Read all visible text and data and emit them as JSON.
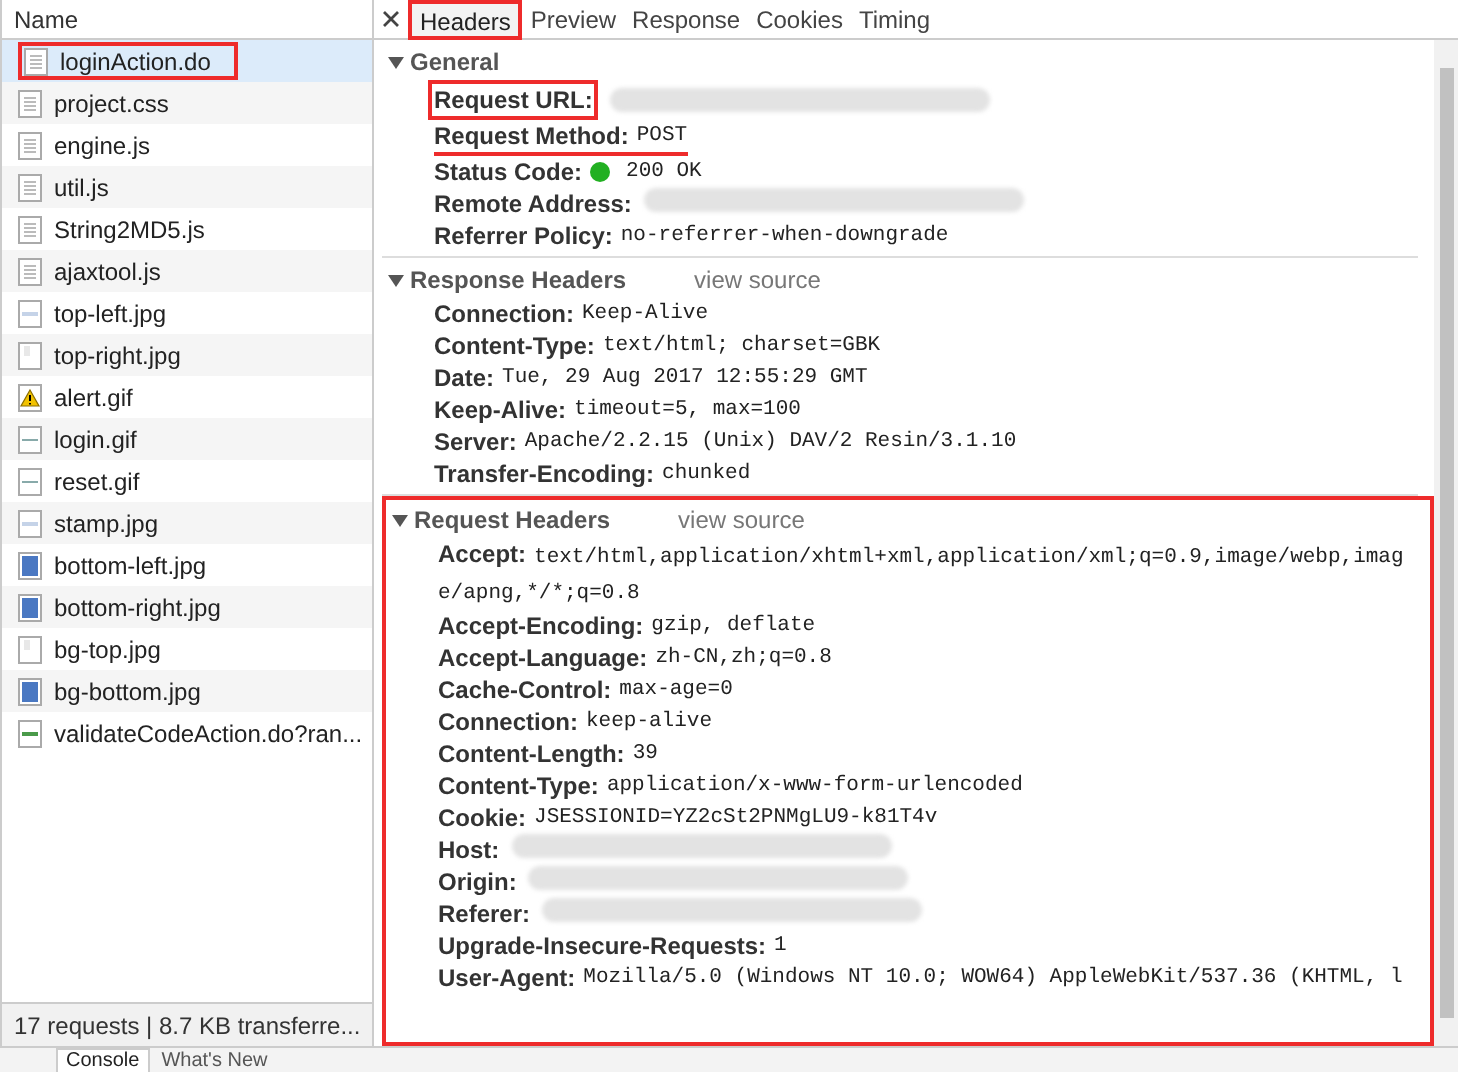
{
  "files": {
    "column": "Name",
    "items": [
      {
        "name": "loginAction.do",
        "kind": "document",
        "selected": true,
        "boxed": true
      },
      {
        "name": "project.css",
        "kind": "document",
        "selected": false
      },
      {
        "name": "engine.js",
        "kind": "document",
        "selected": false
      },
      {
        "name": "util.js",
        "kind": "document",
        "selected": false
      },
      {
        "name": "String2MD5.js",
        "kind": "document",
        "selected": false
      },
      {
        "name": "ajaxtool.js",
        "kind": "document",
        "selected": false
      },
      {
        "name": "top-left.jpg",
        "kind": "image-light",
        "selected": false
      },
      {
        "name": "top-right.jpg",
        "kind": "image-blank",
        "selected": false
      },
      {
        "name": "alert.gif",
        "kind": "warning",
        "selected": false
      },
      {
        "name": "login.gif",
        "kind": "image-line",
        "selected": false
      },
      {
        "name": "reset.gif",
        "kind": "image-line",
        "selected": false
      },
      {
        "name": "stamp.jpg",
        "kind": "image-light",
        "selected": false
      },
      {
        "name": "bottom-left.jpg",
        "kind": "image-blue",
        "selected": false
      },
      {
        "name": "bottom-right.jpg",
        "kind": "image-blue",
        "selected": false
      },
      {
        "name": "bg-top.jpg",
        "kind": "image-blank",
        "selected": false
      },
      {
        "name": "bg-bottom.jpg",
        "kind": "image-blue",
        "selected": false
      },
      {
        "name": "validateCodeAction.do?ran...",
        "kind": "image-green",
        "selected": false
      }
    ],
    "summary": "17 requests | 8.7 KB transferre..."
  },
  "drawer_tabs": [
    {
      "label": "Console",
      "selected": true
    },
    {
      "label": "What's New",
      "selected": false
    }
  ],
  "tabs": [
    {
      "label": "Headers",
      "selected": true,
      "boxed": true
    },
    {
      "label": "Preview",
      "selected": false
    },
    {
      "label": "Response",
      "selected": false
    },
    {
      "label": "Cookies",
      "selected": false
    },
    {
      "label": "Timing",
      "selected": false
    }
  ],
  "sections": [
    {
      "title": "General",
      "expanded": true,
      "rows": [
        {
          "label": "Request URL:",
          "redacted": true,
          "boxed": true
        },
        {
          "label": "Request Method:",
          "value": "POST",
          "underlined": true
        },
        {
          "label": "Status Code:",
          "value": "200 OK",
          "kind": "status"
        },
        {
          "label": "Remote Address:",
          "redacted": true
        },
        {
          "label": "Referrer Policy:",
          "value": "no-referrer-when-downgrade"
        }
      ]
    },
    {
      "title": "Response Headers",
      "link": "view source",
      "expanded": true,
      "rows": [
        {
          "label": "Connection:",
          "value": "Keep-Alive"
        },
        {
          "label": "Content-Type:",
          "value": "text/html; charset=GBK"
        },
        {
          "label": "Date:",
          "value": "Tue, 29 Aug 2017 12:55:29 GMT"
        },
        {
          "label": "Keep-Alive:",
          "value": "timeout=5, max=100"
        },
        {
          "label": "Server:",
          "value": "Apache/2.2.15 (Unix) DAV/2 Resin/3.1.10"
        },
        {
          "label": "Transfer-Encoding:",
          "value": "chunked"
        }
      ]
    },
    {
      "title": "Request Headers",
      "link": "view source",
      "expanded": true,
      "boxed": true,
      "rows": [
        {
          "label": "Accept:",
          "value": "text/html,application/xhtml+xml,application/xml;q=0.9,image/webp,image/apng,*/*;q=0.8"
        },
        {
          "label": "Accept-Encoding:",
          "value": "gzip, deflate"
        },
        {
          "label": "Accept-Language:",
          "value": "zh-CN,zh;q=0.8"
        },
        {
          "label": "Cache-Control:",
          "value": "max-age=0"
        },
        {
          "label": "Connection:",
          "value": "keep-alive"
        },
        {
          "label": "Content-Length:",
          "value": "39"
        },
        {
          "label": "Content-Type:",
          "value": "application/x-www-form-urlencoded"
        },
        {
          "label": "Cookie:",
          "value": "JSESSIONID=YZ2cSt2PNMgLU9-k81T4v"
        },
        {
          "label": "Host:",
          "redacted": true
        },
        {
          "label": "Origin:",
          "redacted": true
        },
        {
          "label": "Referer:",
          "redacted": true
        },
        {
          "label": "Upgrade-Insecure-Requests:",
          "value": "1"
        },
        {
          "label": "User-Agent:",
          "value": "Mozilla/5.0 (Windows NT 10.0; WOW64) AppleWebKit/537.36 (KHTML, l"
        }
      ]
    }
  ]
}
